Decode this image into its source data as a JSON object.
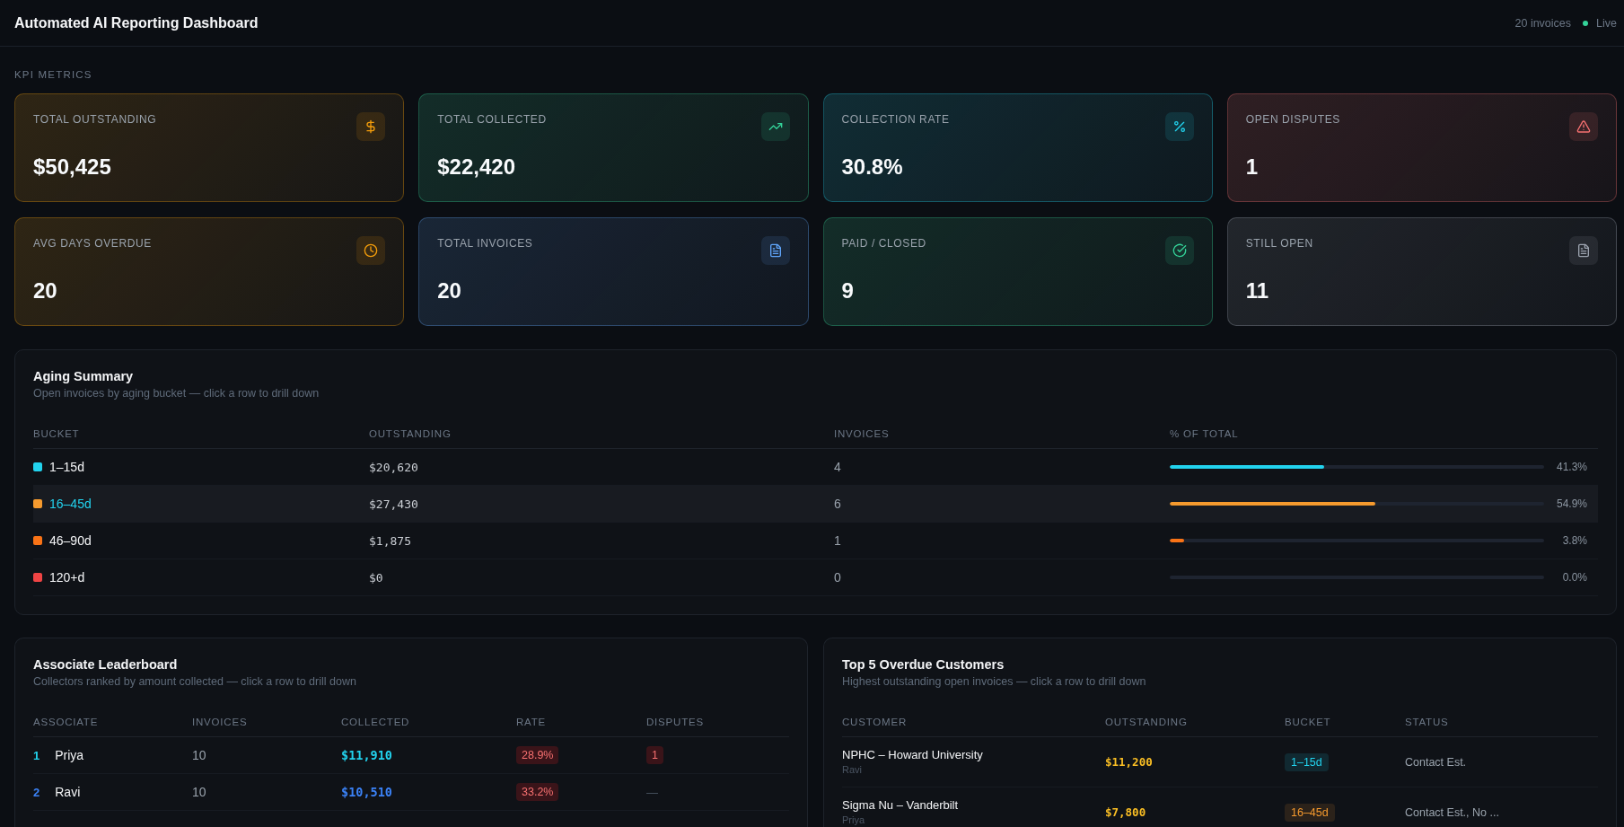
{
  "header": {
    "title": "Automated AI Reporting Dashboard",
    "invoice_count": "20 invoices",
    "status": {
      "label": "Live",
      "live": true
    }
  },
  "kpi": {
    "heading": "KPI METRICS",
    "cards": [
      {
        "label": "TOTAL OUTSTANDING",
        "value": "$50,425",
        "color": "#f59e0b"
      },
      {
        "label": "TOTAL COLLECTED",
        "value": "$22,420",
        "color": "#34d399"
      },
      {
        "label": "COLLECTION RATE",
        "value": "30.8%",
        "color": "#22d3ee"
      },
      {
        "label": "OPEN DISPUTES",
        "value": "1",
        "color": "#f87171"
      },
      {
        "label": "AVG DAYS OVERDUE",
        "value": "20",
        "color": "#f59e0b"
      },
      {
        "label": "TOTAL INVOICES",
        "value": "20",
        "color": "#60a5fa"
      },
      {
        "label": "PAID / CLOSED",
        "value": "9",
        "color": "#34d399"
      },
      {
        "label": "STILL OPEN",
        "value": "11",
        "color": "#9ca3af"
      }
    ]
  },
  "aging": {
    "title": "Aging Summary",
    "subtitle": "Open invoices by aging bucket — click a row to drill down",
    "columns": [
      "BUCKET",
      "OUTSTANDING",
      "INVOICES",
      "% OF TOTAL"
    ],
    "rows": [
      {
        "bucket": "1–15d",
        "color": "#22d3ee",
        "outstanding": "$20,620",
        "invoices": "4",
        "level": 0.413,
        "percent": "41.3%",
        "selected": false
      },
      {
        "bucket": "16–45d",
        "color": "#f59a2e",
        "outstanding": "$27,430",
        "invoices": "6",
        "level": 0.549,
        "percent": "54.9%",
        "selected": true
      },
      {
        "bucket": "46–90d",
        "color": "#f97316",
        "outstanding": "$1,875",
        "invoices": "1",
        "level": 0.038,
        "percent": "3.8%",
        "selected": false
      },
      {
        "bucket": "120+d",
        "color": "#ef4444",
        "outstanding": "$0",
        "invoices": "0",
        "level": 0,
        "percent": "0.0%",
        "selected": false
      }
    ]
  },
  "leaderboard": {
    "title": "Associate Leaderboard",
    "subtitle": "Collectors ranked by amount collected — click a row to drill down",
    "columns": [
      "ASSOCIATE",
      "INVOICES",
      "COLLECTED",
      "RATE",
      "DISPUTES"
    ],
    "rows": [
      {
        "rank": "1",
        "name": "Priya",
        "color": "#22d3ee",
        "invoices": "10",
        "collected": "$11,910",
        "rate": "28.9%",
        "disputes": {
          "text": "1",
          "flagged": true
        }
      },
      {
        "rank": "2",
        "name": "Ravi",
        "color": "#3b82f6",
        "invoices": "10",
        "collected": "$10,510",
        "rate": "33.2%",
        "disputes": {
          "text": "—",
          "flagged": false
        }
      }
    ]
  },
  "top_customers": {
    "title": "Top 5 Overdue Customers",
    "subtitle": "Highest outstanding open invoices — click a row to drill down",
    "columns": [
      "CUSTOMER",
      "OUTSTANDING",
      "BUCKET",
      "STATUS"
    ],
    "rows": [
      {
        "customer": "NPHC – Howard University",
        "associate": "Ravi",
        "outstanding": "$11,200",
        "bucket": {
          "label": "1–15d",
          "color": "#22d3ee"
        },
        "status": "Contact Est."
      },
      {
        "customer": "Sigma Nu – Vanderbilt",
        "associate": "Priya",
        "outstanding": "$7,800",
        "bucket": {
          "label": "16–45d",
          "color": "#f59a2e"
        },
        "status": "Contact Est., No ..."
      }
    ]
  }
}
